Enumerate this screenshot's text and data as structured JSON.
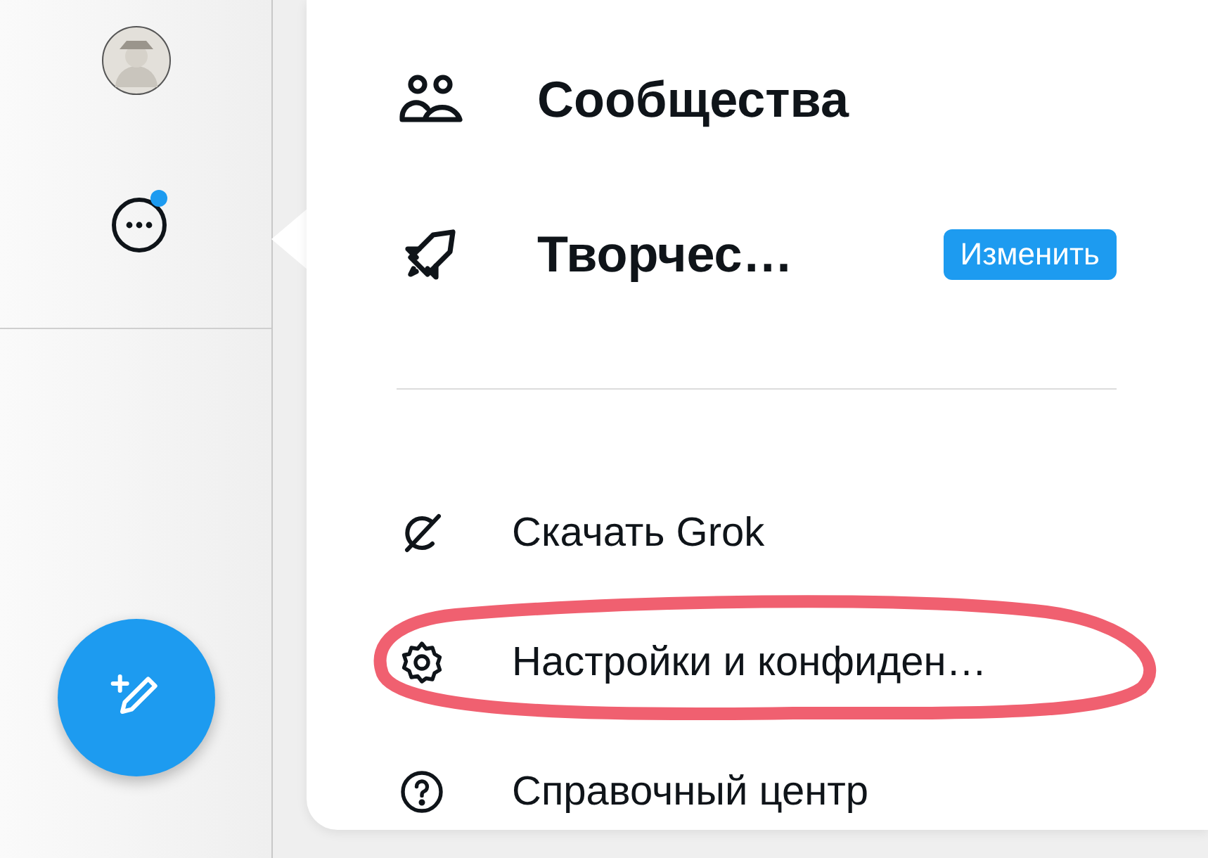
{
  "sidebar": {
    "more_notification": true
  },
  "menu": {
    "items": [
      {
        "kind": "large",
        "label": "Сообщества"
      },
      {
        "kind": "large",
        "label": "Творчес…",
        "action": "Изменить"
      },
      {
        "kind": "divider"
      },
      {
        "kind": "small",
        "label": "Скачать Grok"
      },
      {
        "kind": "small",
        "label": "Настройки и конфиден…",
        "circled": true
      },
      {
        "kind": "small",
        "label": "Справочный центр"
      }
    ]
  }
}
